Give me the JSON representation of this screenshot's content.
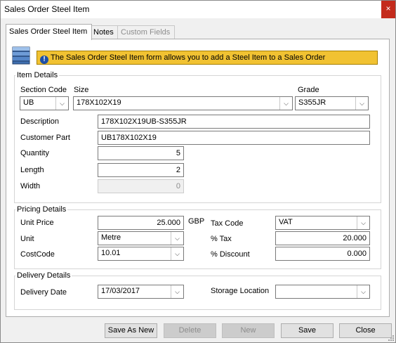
{
  "window": {
    "title": "Sales Order Steel Item",
    "close_label": "×"
  },
  "tabs": [
    {
      "label": "Sales Order Steel Item"
    },
    {
      "label": "Notes"
    },
    {
      "label": "Custom Fields"
    }
  ],
  "info": {
    "icon_text": "!",
    "text": "The Sales Order Steel Item form allows you to add a Steel Item to a Sales Order"
  },
  "item_details": {
    "legend": "Item Details",
    "section_code_label": "Section Code",
    "section_code_value": "UB",
    "size_label": "Size",
    "size_value": "178X102X19",
    "grade_label": "Grade",
    "grade_value": "S355JR",
    "description_label": "Description",
    "description_value": "178X102X19UB-S355JR",
    "customer_part_label": "Customer Part",
    "customer_part_value": "UB178X102X19",
    "quantity_label": "Quantity",
    "quantity_value": "5",
    "length_label": "Length",
    "length_value": "2",
    "width_label": "Width",
    "width_value": "0"
  },
  "pricing_details": {
    "legend": "Pricing Details",
    "unit_price_label": "Unit Price",
    "unit_price_value": "25.000",
    "currency": "GBP",
    "unit_label": "Unit",
    "unit_value": "Metre",
    "cost_code_label": "CostCode",
    "cost_code_value": "10.01",
    "tax_code_label": "Tax Code",
    "tax_code_value": "VAT",
    "tax_pct_label": "% Tax",
    "tax_pct_value": "20.000",
    "discount_label": "% Discount",
    "discount_value": "0.000"
  },
  "delivery_details": {
    "legend": "Delivery Details",
    "delivery_date_label": "Delivery Date",
    "delivery_date_value": "17/03/2017",
    "storage_location_label": "Storage Location",
    "storage_location_value": ""
  },
  "buttons": {
    "save_as_new": "Save As New",
    "delete": "Delete",
    "new": "New",
    "save": "Save",
    "close": "Close"
  },
  "icons": {
    "dropdown_arrow": "chevron-down-icon",
    "form_icon": "database-stack-icon",
    "info": "info-icon"
  },
  "colors": {
    "info_bar": "#f1c232",
    "close_button": "#c42b1c"
  }
}
